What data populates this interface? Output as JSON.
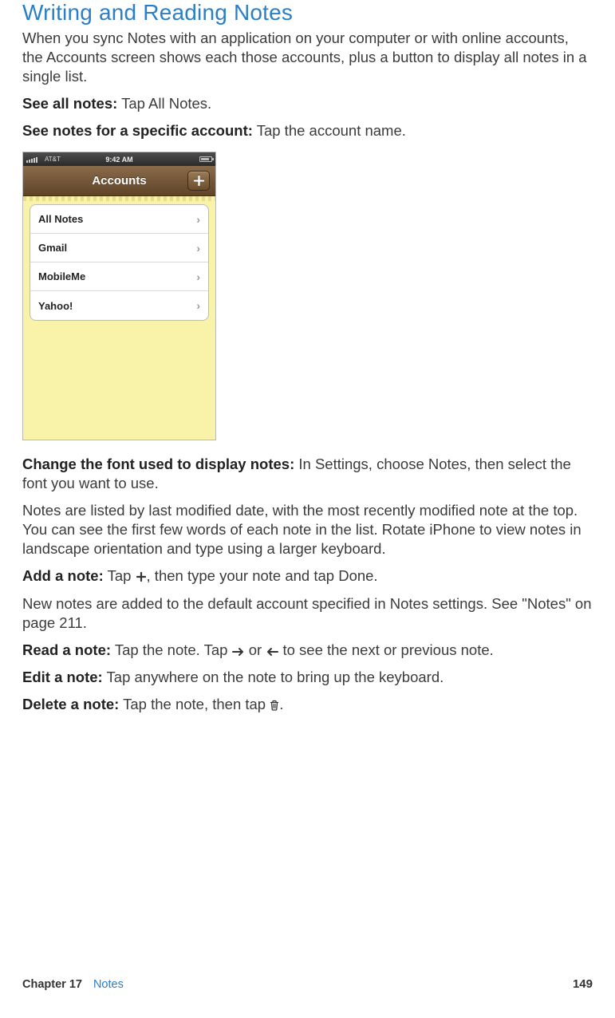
{
  "heading": "Writing and Reading Notes",
  "intro": "When you sync Notes with an application on your computer or with online accounts, the Accounts screen shows each those accounts, plus a button to display all notes in a single list.",
  "see_all_label": "See all notes:",
  "see_all_text": "Tap All Notes.",
  "see_specific_label": "See notes for a specific account:",
  "see_specific_text": "Tap the account name.",
  "screenshot": {
    "status_carrier": "AT&T",
    "status_time": "9:42 AM",
    "nav_title": "Accounts",
    "rows": [
      {
        "label": "All Notes",
        "bold": true
      },
      {
        "label": "Gmail",
        "bold": true
      },
      {
        "label": "MobileMe",
        "bold": true
      },
      {
        "label": "Yahoo!",
        "bold": true
      }
    ]
  },
  "change_font_label": "Change the font used to display notes:",
  "change_font_text": "In Settings, choose Notes, then select the font you want to use.",
  "listing_text": "Notes are listed by last modified date, with the most recently modified note at the top. You can see the first few words of each note in the list. Rotate iPhone to view notes in landscape orientation and type using a larger keyboard.",
  "add_note_label": "Add a note:",
  "add_note_before": "Tap ",
  "add_note_after": ", then type your note and tap Done.",
  "new_notes_text": "New notes are added to the default account specified in Notes settings. See \"Notes\" on page 211.",
  "read_note_label": "Read a note:",
  "read_note_before": "Tap the note. Tap ",
  "read_note_mid": " or ",
  "read_note_after": " to see the next or previous note.",
  "edit_note_label": "Edit a note:",
  "edit_note_text": "Tap anywhere on the note to bring up the keyboard.",
  "delete_note_label": "Delete a note:",
  "delete_note_before": "Tap the note, then tap ",
  "delete_note_after": ".",
  "footer": {
    "chapter_label": "Chapter 17",
    "chapter_title": "Notes",
    "page_num": "149"
  }
}
